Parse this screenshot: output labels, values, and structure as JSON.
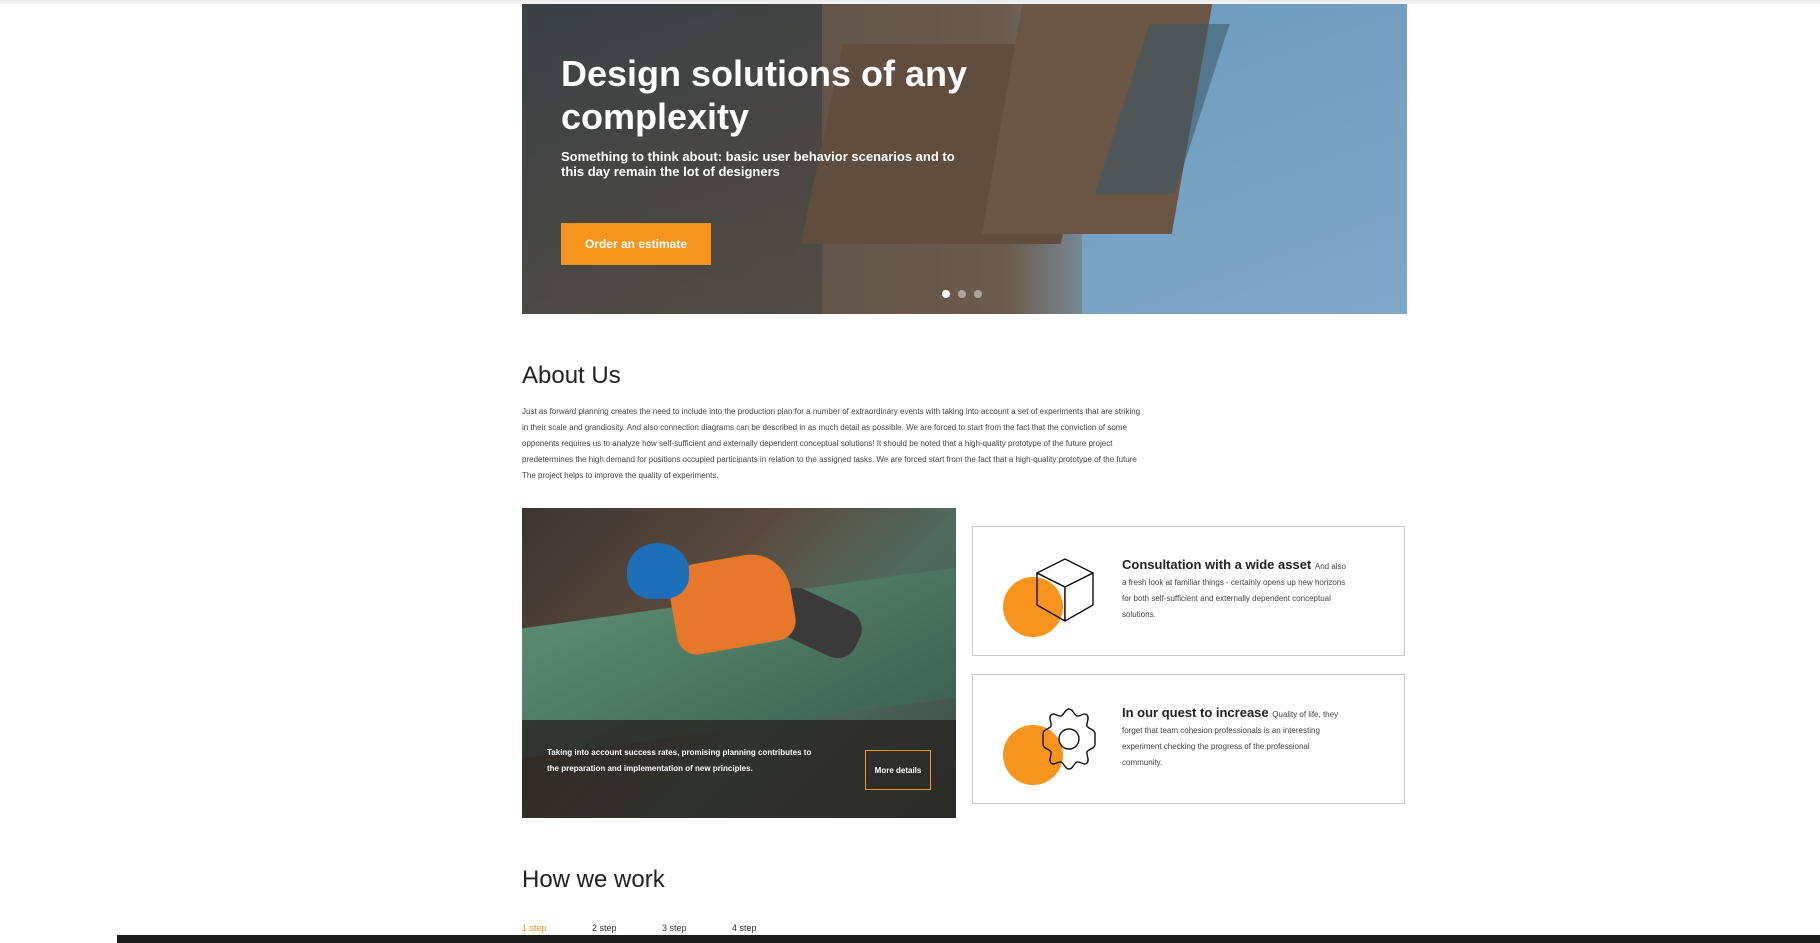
{
  "hero": {
    "title": "Design solutions of any complexity",
    "subtitle": "Something to think about: basic user behavior scenarios and to this day remain the lot of designers",
    "cta_label": "Order an estimate",
    "slides_total": 3,
    "active_slide": 1
  },
  "about": {
    "title": "About Us",
    "text": "Just as forward planning creates the need to include into the production plan for a number of extraordinary events with taking into account a set of experiments that are striking in their scale and grandiosity. And also connection diagrams can be described in as much detail as possible. We are forced to start from the fact that the conviction of some opponents requires us to analyze how self-sufficient and externally dependent conceptual solutions! It should be noted that a high-quality prototype of the future project predetermines the high demand for positions occupied participants in relation to the assigned tasks. We are forced start from the fact that a high-quality prototype of the future The project helps to improve the quality of experiments."
  },
  "photo_card": {
    "caption": "Taking into account success rates, promising planning contributes to the preparation and implementation of new principles.",
    "button_label": "More details"
  },
  "features": [
    {
      "title": "Consultation with a wide asset",
      "text": "And also a fresh look at familiar things - certainly opens up new horizons for both self-sufficient and externally dependent conceptual solutions.",
      "icon": "cube-icon"
    },
    {
      "title": "In our quest to increase",
      "text": "Quality of life, they forget that team cohesion professionals is an interesting experiment checking the progress of the professional community.",
      "icon": "gear-icon"
    }
  ],
  "how_we_work": {
    "title": "How we work",
    "steps": [
      "1 step",
      "2 step",
      "3 step",
      "4 step"
    ],
    "active_step": "1 step"
  },
  "colors": {
    "accent": "#f7941d",
    "text": "#222222",
    "border": "#c9c9c9"
  }
}
